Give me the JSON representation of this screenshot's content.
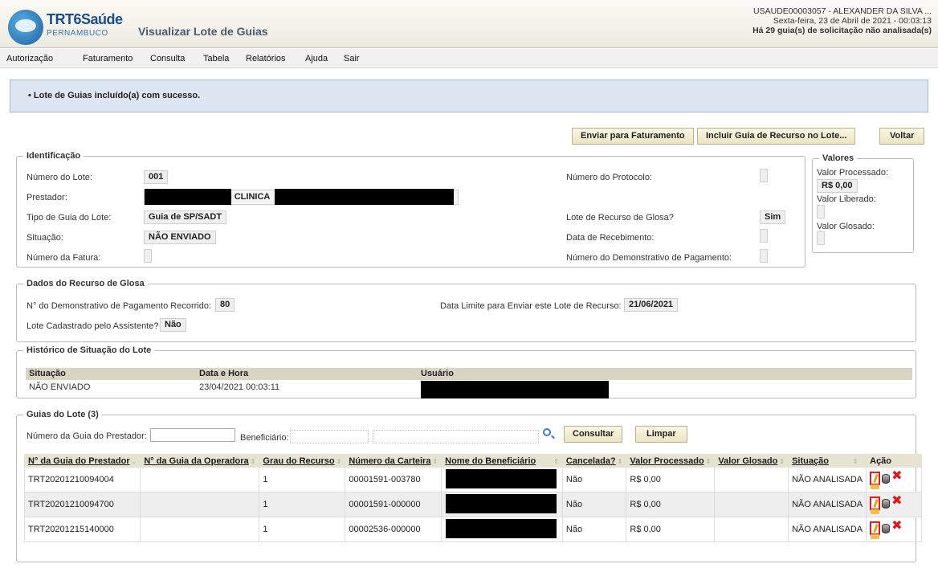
{
  "header": {
    "logo_title": "TRT6Saúde",
    "logo_subtitle": "PERNAMBUCO",
    "page_title": "Visualizar Lote de Guias",
    "user_line": "USAUDE00003057 - ALEXANDER DA SILVA ...",
    "date_line": "Sexta-feira, 23 de Abril de 2021 - 00:03:13",
    "pending_line": "Há 29 guia(s) de solicitação não analisada(s)"
  },
  "menu": [
    "Autorização",
    "Faturamento",
    "Consulta",
    "Tabela",
    "Relatórios",
    "Ajuda",
    "Sair"
  ],
  "alert": {
    "message": "Lote de Guias incluído(a) com sucesso."
  },
  "actions": {
    "enviar": "Enviar para Faturamento",
    "incluir": "Incluir Guia de Recurso no Lote...",
    "voltar": "Voltar"
  },
  "identificacao": {
    "legend": "Identificação",
    "numero_lote_label": "Número do Lote:",
    "numero_lote": "001",
    "prestador_label": "Prestador:",
    "prestador_text": "- CLINICA",
    "tipo_label": "Tipo de Guia do Lote:",
    "tipo": "Guia de SP/SADT",
    "situacao_label": "Situação:",
    "situacao": "NÃO ENVIADO",
    "fatura_label": "Número da Fatura:",
    "protocolo_label": "Número do Protocolo:",
    "recurso_label": "Lote de Recurso de Glosa?",
    "recurso": "Sim",
    "recebimento_label": "Data de Recebimento:",
    "demonstrativo_label": "Número do Demonstrativo de Pagamento:"
  },
  "valores": {
    "legend": "Valores",
    "processado_label": "Valor Processado:",
    "processado": "R$ 0,00",
    "liberado_label": "Valor Liberado:",
    "glosado_label": "Valor Glosado:"
  },
  "recurso_glosa": {
    "legend": "Dados do Recurso de Glosa",
    "demonstrativo_label": "N° do Demonstrativo de Pagamento Recorrido:",
    "demonstrativo": "80",
    "data_limite_label": "Data Limite para Enviar este Lote de Recurso:",
    "data_limite": "21/06/2021",
    "assistente_label": "Lote Cadastrado pelo Assistente?",
    "assistente": "Não"
  },
  "historico": {
    "legend": "Histórico de Situação do Lote",
    "columns": [
      "Situação",
      "Data e Hora",
      "Usuário"
    ],
    "rows": [
      {
        "situacao": "NÃO ENVIADO",
        "data": "23/04/2021 00:03:11"
      }
    ]
  },
  "guias": {
    "legend": "Guias do Lote (3)",
    "filter_numero_label": "Número da Guia do Prestador:",
    "filter_benef_label": "Beneficiário:",
    "consultar": "Consultar",
    "limpar": "Limpar",
    "columns": [
      "N° da Guia do Prestador",
      "N° da Guia da Operadora",
      "Grau do Recurso",
      "Número da Carteira",
      "Nome do Beneficiário",
      "Cancelada?",
      "Valor Processado",
      "Valor Glosado",
      "Situação",
      "Ação"
    ],
    "rows": [
      {
        "guia": "TRT20201210094004",
        "operadora": "",
        "grau": "1",
        "carteira": "00001591-003780",
        "cancelada": "Não",
        "processado": "R$ 0,00",
        "glosado": "",
        "situacao": "NÃO ANALISADA"
      },
      {
        "guia": "TRT20201210094700",
        "operadora": "",
        "grau": "1",
        "carteira": "00001591-000000",
        "cancelada": "Não",
        "processado": "R$ 0,00",
        "glosado": "",
        "situacao": "NÃO ANALISADA"
      },
      {
        "guia": "TRT20201215140000",
        "operadora": "",
        "grau": "1",
        "carteira": "00002536-000000",
        "cancelada": "Não",
        "processado": "R$ 0,00",
        "glosado": "",
        "situacao": "NÃO ANALISADA"
      }
    ]
  }
}
